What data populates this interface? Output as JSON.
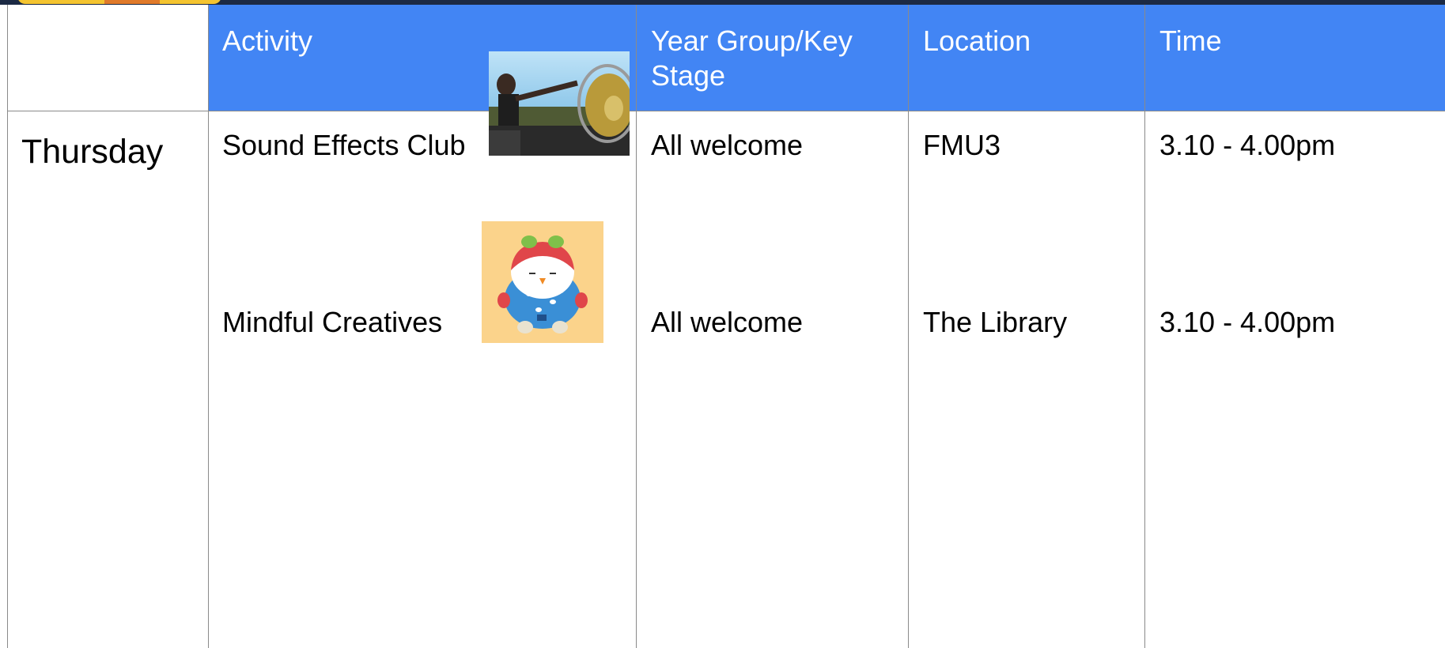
{
  "table": {
    "headers": {
      "activity": "Activity",
      "year_group": "Year Group/Key Stage",
      "location": "Location",
      "time": "Time"
    },
    "day": "Thursday",
    "rows": [
      {
        "activity": "Sound Effects  Club",
        "year_group": "All welcome",
        "location": "FMU3",
        "time": "3.10 - 4.00pm",
        "image": "gong-photo"
      },
      {
        "activity": "Mindful Creatives",
        "year_group": "All welcome",
        "location": "The Library",
        "time": "3.10 - 4.00pm",
        "image": "penguin-illustration"
      }
    ]
  },
  "colors": {
    "header_bg": "#4285f4",
    "header_text": "#ffffff",
    "top_strip": "#1c2a44",
    "logo_yellow": "#f4c430",
    "penguin_tile": "#fbd38b"
  }
}
